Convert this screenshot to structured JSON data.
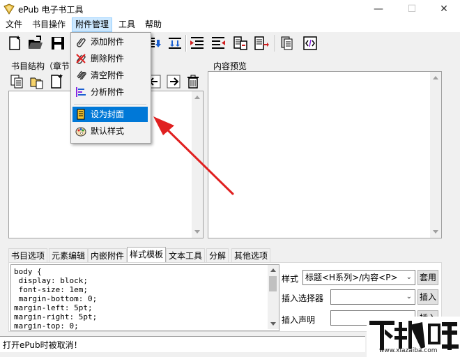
{
  "window": {
    "title": "ePub 电子书工具",
    "minimize_glyph": "—",
    "maximize_glyph": "☐",
    "close_glyph": "✕"
  },
  "menubar": {
    "items": [
      {
        "label": "文件"
      },
      {
        "label": "书目操作"
      },
      {
        "label": "附件管理"
      },
      {
        "label": "工具"
      },
      {
        "label": "帮助"
      }
    ]
  },
  "attachment_menu": {
    "items": [
      {
        "label": "添加附件",
        "icon": "paperclip-add-icon"
      },
      {
        "label": "删除附件",
        "icon": "paperclip-delete-icon"
      },
      {
        "label": "清空附件",
        "icon": "paperclip-clear-icon"
      },
      {
        "label": "分析附件",
        "icon": "analyze-icon"
      },
      {
        "label": "设为封面",
        "icon": "cover-icon",
        "highlighted": true
      },
      {
        "label": "默认样式",
        "icon": "palette-icon"
      }
    ]
  },
  "left_panel": {
    "label": "书目结构（章节"
  },
  "right_panel": {
    "label": "内容预览"
  },
  "tabs": [
    {
      "label": "书目选项"
    },
    {
      "label": "元素编辑"
    },
    {
      "label": "内嵌附件"
    },
    {
      "label": "样式模板",
      "active": true
    },
    {
      "label": "文本工具"
    },
    {
      "label": "分解"
    },
    {
      "label": "其他选项"
    }
  ],
  "css_editor": {
    "lines": [
      "body {",
      " display: block;",
      " font-size: 1em;",
      " margin-bottom: 0;",
      "margin-left: 5pt;",
      "margin-right: 5pt;",
      "margin-top: 0;"
    ]
  },
  "style_form": {
    "style_label": "样式",
    "style_value": "标题<H系列>/内容<P>",
    "apply_button": "套用",
    "selector_label": "插入选择器",
    "selector_value": "",
    "insert_button": "插入",
    "declaration_label": "插入声明",
    "declaration_value": "",
    "insert2_button": "插入"
  },
  "status": {
    "text": "打开ePub时被取消！"
  },
  "watermark": {
    "text": "下载吧",
    "url": "www.xiazaiba.com"
  },
  "colors": {
    "highlight": "#0078d7",
    "arrow": "#e02020",
    "menu_active": "#cce8ff"
  }
}
